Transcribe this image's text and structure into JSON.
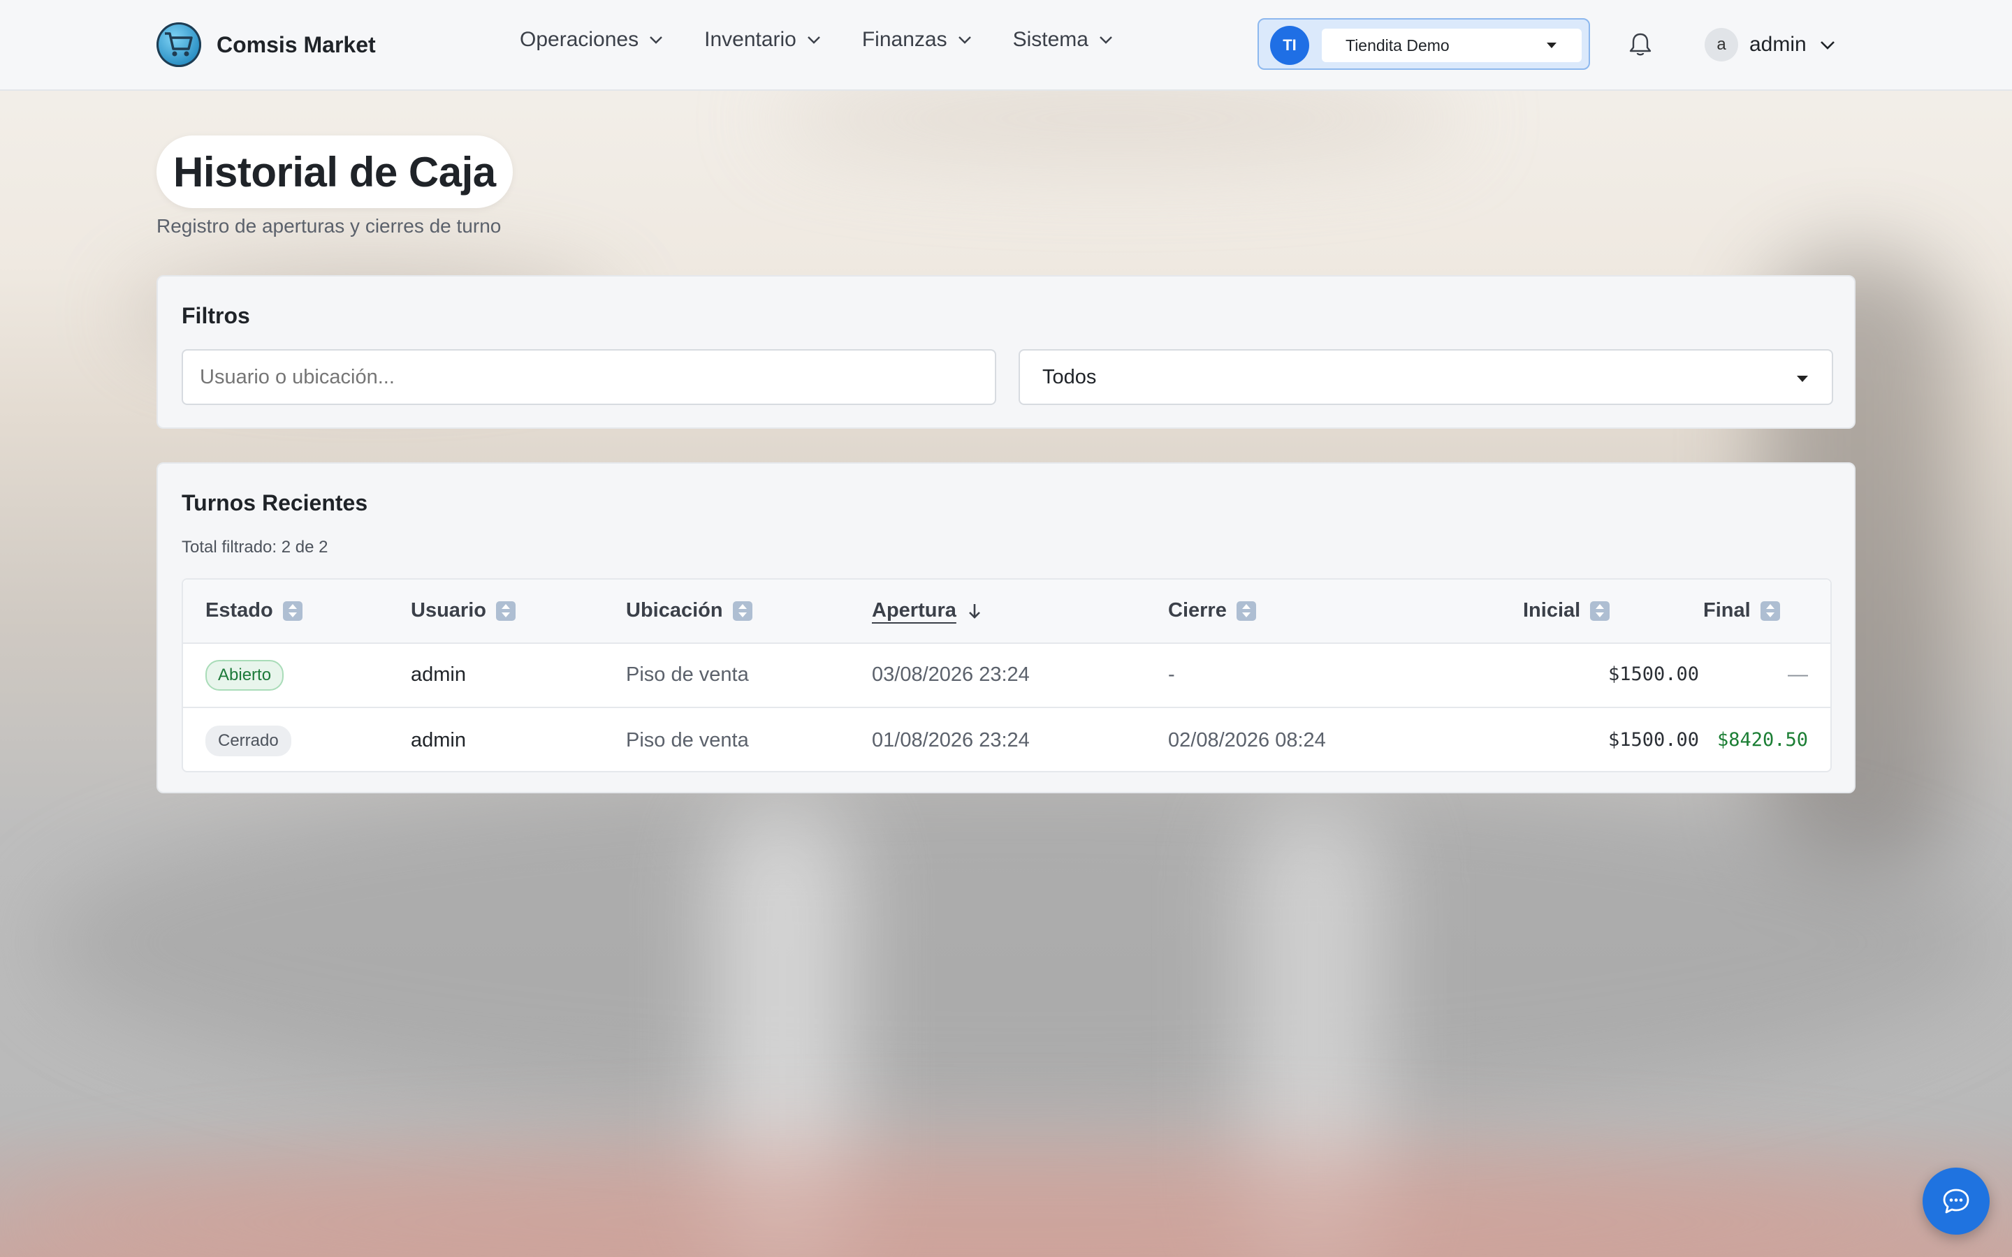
{
  "app": {
    "brand_name": "Comsis Market",
    "logo_icon": "shopping-cart-icon"
  },
  "nav": {
    "items": [
      {
        "label": "Operaciones"
      },
      {
        "label": "Inventario"
      },
      {
        "label": "Finanzas"
      },
      {
        "label": "Sistema"
      }
    ]
  },
  "store_switcher": {
    "initials": "TI",
    "selected": "Tiendita Demo"
  },
  "user_menu": {
    "avatar_letter": "a",
    "name": "admin"
  },
  "page": {
    "title": "Historial de Caja",
    "subtitle": "Registro de aperturas y cierres de turno"
  },
  "filters": {
    "title": "Filtros",
    "search_placeholder": "Usuario o ubicación...",
    "search_value": "",
    "status_selected": "Todos"
  },
  "shifts": {
    "title": "Turnos Recientes",
    "total_text": "Total filtrado: 2 de 2",
    "columns": {
      "estado": "Estado",
      "usuario": "Usuario",
      "ubicacion": "Ubicación",
      "apertura": "Apertura",
      "cierre": "Cierre",
      "inicial": "Inicial",
      "final": "Final"
    },
    "sorted_by": "Apertura",
    "sort_direction": "desc",
    "rows": [
      {
        "estado": "Abierto",
        "usuario": "admin",
        "ubicacion": "Piso de venta",
        "apertura": "03/08/2026 23:24",
        "cierre": "-",
        "inicial": "$1500.00",
        "final": "—"
      },
      {
        "estado": "Cerrado",
        "usuario": "admin",
        "ubicacion": "Piso de venta",
        "apertura": "01/08/2026 23:24",
        "cierre": "02/08/2026 08:24",
        "inicial": "$1500.00",
        "final": "$8420.50"
      }
    ]
  },
  "colors": {
    "accent": "#1f73e0",
    "status_open": "#1d7a3a",
    "money_positive": "#1b7e34"
  }
}
